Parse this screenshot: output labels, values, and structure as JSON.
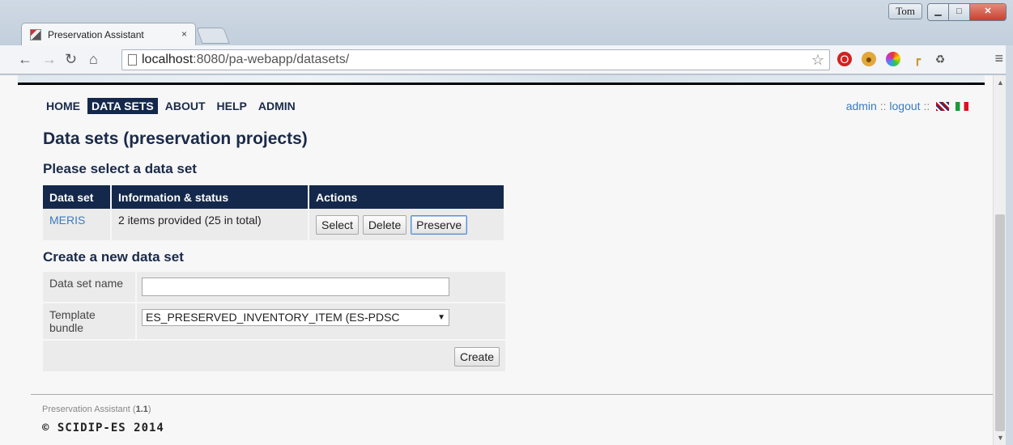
{
  "browser": {
    "tab_title": "Preservation Assistant",
    "tab_close": "×",
    "user_button": "Tom",
    "url_host": "localhost",
    "url_rest": ":8080/pa-webapp/datasets/"
  },
  "nav": {
    "items": [
      "HOME",
      "DATA SETS",
      "ABOUT",
      "HELP",
      "ADMIN"
    ],
    "active": "DATA SETS",
    "user": "admin",
    "sep": "::",
    "logout": "logout"
  },
  "page": {
    "title": "Data sets (preservation projects)",
    "select_heading": "Please select a data set",
    "create_heading": "Create a new data set"
  },
  "table": {
    "headers": [
      "Data set",
      "Information & status",
      "Actions"
    ],
    "rows": [
      {
        "name": "MERIS",
        "info": "2 items provided (25 in total)",
        "actions": [
          "Select",
          "Delete",
          "Preserve"
        ]
      }
    ]
  },
  "form": {
    "name_label": "Data set name",
    "name_value": "",
    "template_label": "Template bundle",
    "template_value": "ES_PRESERVED_INVENTORY_ITEM (ES-PDSC",
    "create_button": "Create"
  },
  "footer": {
    "app_name": "Preservation Assistant",
    "version": "1.1",
    "copyright": "© SCIDIP-ES 2014"
  }
}
